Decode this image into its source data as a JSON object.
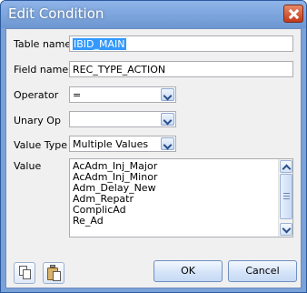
{
  "window": {
    "title": "Edit Condition"
  },
  "form": {
    "table_name": {
      "label": "Table name",
      "value": "IBID_MAIN"
    },
    "field_name": {
      "label": "Field name",
      "value": "REC_TYPE_ACTION"
    },
    "operator": {
      "label": "Operator",
      "value": "="
    },
    "unary_op": {
      "label": "Unary Op",
      "value": ""
    },
    "value_type": {
      "label": "Value Type",
      "value": "Multiple Values"
    },
    "value": {
      "label": "Value",
      "items": [
        "AcAdm_Inj_Major",
        "AcAdm_Inj_Minor",
        "Adm_Delay_New",
        "Adm_Repatr",
        "ComplicAd",
        "Re_Ad"
      ]
    }
  },
  "toolbar": {
    "copy_icon": "copy-icon",
    "paste_icon": "paste-icon"
  },
  "buttons": {
    "ok": "OK",
    "cancel": "Cancel"
  },
  "colors": {
    "titlebar": "#7aa1d8",
    "selection": "#3399ff",
    "client_bg": "#f0f0f0"
  }
}
